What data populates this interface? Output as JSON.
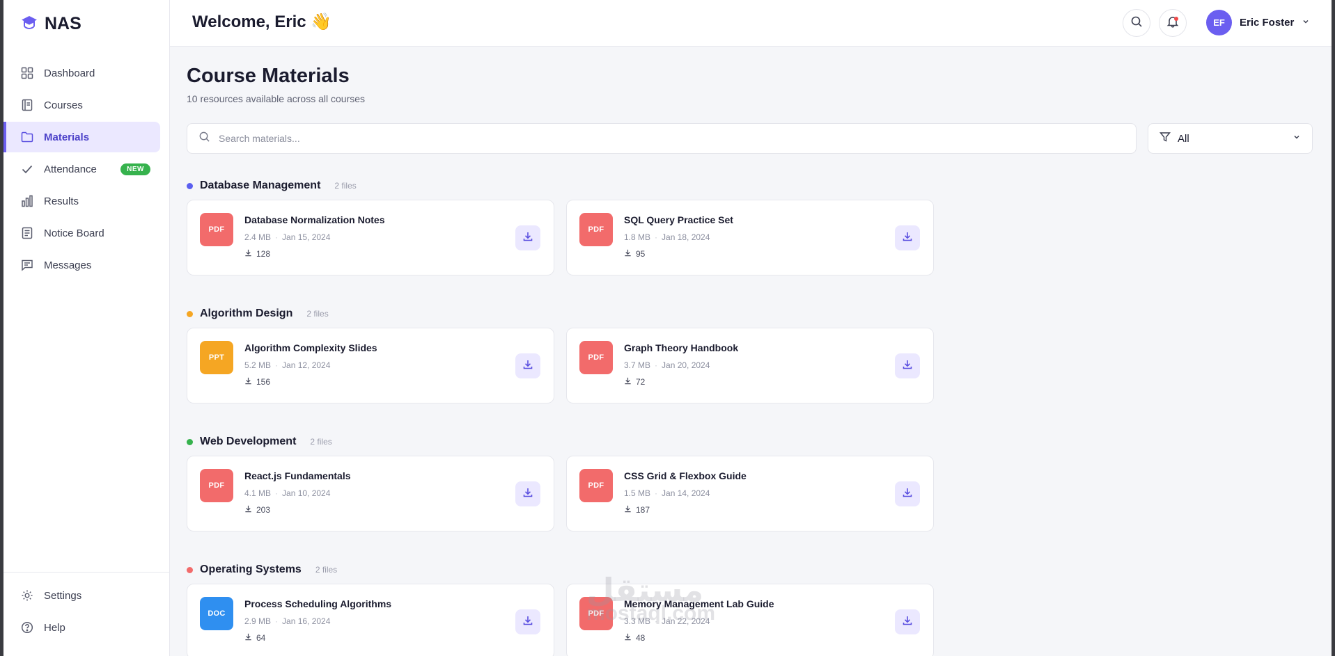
{
  "brand": {
    "name": "NAS"
  },
  "sidebar": {
    "items": [
      {
        "label": "Dashboard",
        "icon": "grid-icon"
      },
      {
        "label": "Courses",
        "icon": "book-icon"
      },
      {
        "label": "Materials",
        "icon": "folder-icon",
        "active": true
      },
      {
        "label": "Attendance",
        "icon": "check-icon",
        "badge": "NEW"
      },
      {
        "label": "Results",
        "icon": "bar-chart-icon"
      },
      {
        "label": "Notice Board",
        "icon": "clipboard-icon"
      },
      {
        "label": "Messages",
        "icon": "message-icon"
      }
    ],
    "bottom": [
      {
        "label": "Settings",
        "icon": "gear-icon"
      },
      {
        "label": "Help",
        "icon": "help-icon"
      }
    ]
  },
  "header": {
    "welcome": "Welcome, Eric 👋",
    "user": {
      "initials": "EF",
      "name": "Eric Foster"
    }
  },
  "page": {
    "title": "Course Materials",
    "subtitle": "10 resources available across all courses",
    "search_placeholder": "Search materials...",
    "filter_value": "All"
  },
  "colors": {
    "accent": "#6b5ef0",
    "pdf": "#f26b6b",
    "ppt": "#f5a623",
    "doc": "#2f8ff0"
  },
  "sections": [
    {
      "title": "Database Management",
      "count": "2 files",
      "dot": "#5b5ff0",
      "files": [
        {
          "type": "PDF",
          "name": "Database Normalization Notes",
          "size": "2.4 MB",
          "date": "Jan 15, 2024",
          "downloads": "128"
        },
        {
          "type": "PDF",
          "name": "SQL Query Practice Set",
          "size": "1.8 MB",
          "date": "Jan 18, 2024",
          "downloads": "95"
        }
      ]
    },
    {
      "title": "Algorithm Design",
      "count": "2 files",
      "dot": "#f5a623",
      "files": [
        {
          "type": "PPT",
          "name": "Algorithm Complexity Slides",
          "size": "5.2 MB",
          "date": "Jan 12, 2024",
          "downloads": "156"
        },
        {
          "type": "PDF",
          "name": "Graph Theory Handbook",
          "size": "3.7 MB",
          "date": "Jan 20, 2024",
          "downloads": "72"
        }
      ]
    },
    {
      "title": "Web Development",
      "count": "2 files",
      "dot": "#36b24d",
      "files": [
        {
          "type": "PDF",
          "name": "React.js Fundamentals",
          "size": "4.1 MB",
          "date": "Jan 10, 2024",
          "downloads": "203"
        },
        {
          "type": "PDF",
          "name": "CSS Grid & Flexbox Guide",
          "size": "1.5 MB",
          "date": "Jan 14, 2024",
          "downloads": "187"
        }
      ]
    },
    {
      "title": "Operating Systems",
      "count": "2 files",
      "dot": "#f26b6b",
      "files": [
        {
          "type": "DOC",
          "name": "Process Scheduling Algorithms",
          "size": "2.9 MB",
          "date": "Jan 16, 2024",
          "downloads": "64"
        },
        {
          "type": "PDF",
          "name": "Memory Management Lab Guide",
          "size": "3.3 MB",
          "date": "Jan 22, 2024",
          "downloads": "48"
        }
      ]
    }
  ],
  "watermark": {
    "line1": "مستقل",
    "line2": "mostaql.com"
  }
}
